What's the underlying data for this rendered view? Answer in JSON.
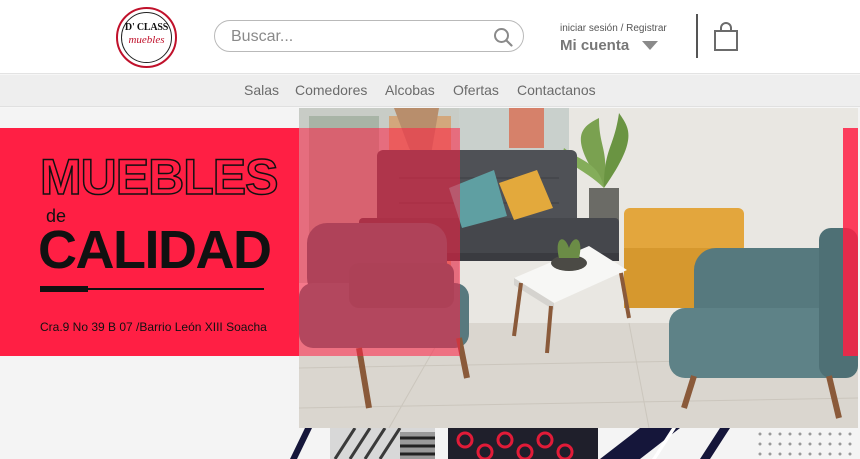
{
  "brand": {
    "line1": "D' CLASS",
    "line2": "muebles"
  },
  "search": {
    "placeholder": "Buscar..."
  },
  "account": {
    "links": "iniciar sesión / Registrar",
    "main": "Mi cuenta"
  },
  "nav": {
    "items": [
      "Salas",
      "Comedores",
      "Alcobas",
      "Ofertas",
      "Contactanos"
    ]
  },
  "hero": {
    "title_top": "MUEBLES",
    "title_mid": "de",
    "title_bottom": "CALIDAD",
    "address": "Cra.9 No 39 B 07 /Barrio León XIII Soacha"
  },
  "colors": {
    "brand_red": "#ff1f44",
    "logo_red": "#c0112b",
    "dark": "#111111"
  },
  "icons": {
    "search": "search-icon",
    "bag": "shopping-bag-icon",
    "account_dropdown": "chevron-down-icon"
  }
}
